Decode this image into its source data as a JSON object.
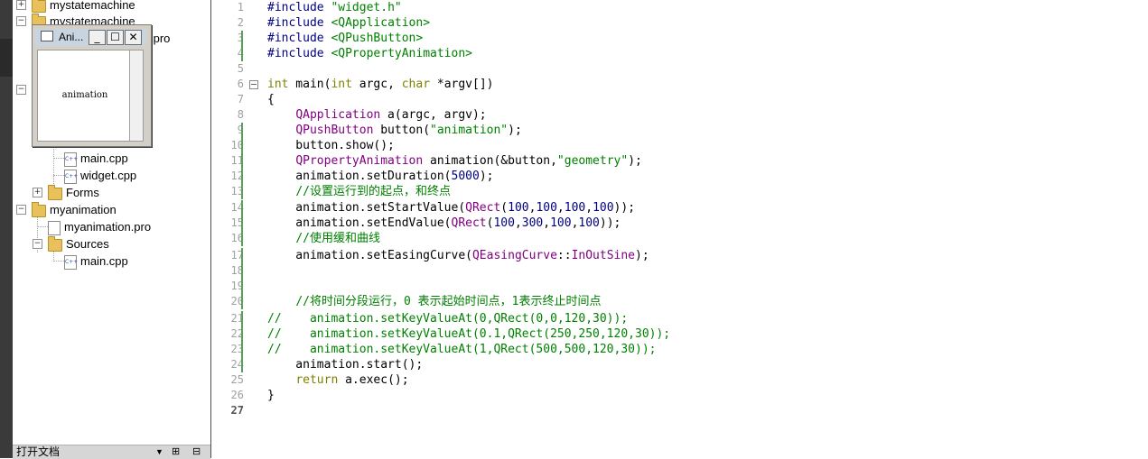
{
  "project_tree": {
    "items": [
      {
        "label": "mystatemachine",
        "kind": "project"
      },
      {
        "label": "mystatemachine",
        "kind": "project"
      },
      {
        "label": ".pro",
        "kind": "pro"
      },
      {
        "label": "main.cpp",
        "kind": "cpp"
      },
      {
        "label": "widget.cpp",
        "kind": "cpp"
      },
      {
        "label": "Forms",
        "kind": "folder"
      },
      {
        "label": "myanimation",
        "kind": "project"
      },
      {
        "label": "myanimation.pro",
        "kind": "pro"
      },
      {
        "label": "Sources",
        "kind": "folder"
      },
      {
        "label": "main.cpp",
        "kind": "cpp"
      }
    ]
  },
  "bottom_bar": {
    "label": "打开文档"
  },
  "anim_window": {
    "title": "Ani...",
    "minimize_glyph": "_",
    "maximize_glyph": "☐",
    "close_glyph": "✕",
    "button_text": "animation"
  },
  "editor": {
    "line_numbers": [
      "1",
      "2",
      "3",
      "4",
      "5",
      "6",
      "7",
      "8",
      "9",
      "10",
      "11",
      "12",
      "13",
      "14",
      "15",
      "16",
      "17",
      "18",
      "19",
      "20",
      "21",
      "22",
      "23",
      "24",
      "25",
      "26",
      "27"
    ],
    "current_line": "27",
    "lines": [
      [
        {
          "t": "#include ",
          "c": "inc"
        },
        {
          "t": "\"widget.h\"",
          "c": "str"
        }
      ],
      [
        {
          "t": "#include ",
          "c": "inc"
        },
        {
          "t": "<QApplication>",
          "c": "str"
        }
      ],
      [
        {
          "t": "#include ",
          "c": "inc"
        },
        {
          "t": "<QPushButton>",
          "c": "str"
        }
      ],
      [
        {
          "t": "#include ",
          "c": "inc"
        },
        {
          "t": "<QPropertyAnimation>",
          "c": "str"
        }
      ],
      [],
      [
        {
          "t": "int",
          "c": "kw"
        },
        {
          "t": " main(",
          "c": ""
        },
        {
          "t": "int",
          "c": "kw"
        },
        {
          "t": " argc, ",
          "c": ""
        },
        {
          "t": "char",
          "c": "kw"
        },
        {
          "t": " *argv[])",
          "c": ""
        }
      ],
      [
        {
          "t": "{",
          "c": ""
        }
      ],
      [
        {
          "t": "    ",
          "c": ""
        },
        {
          "t": "QApplication",
          "c": "cls"
        },
        {
          "t": " a(argc, argv);",
          "c": ""
        }
      ],
      [
        {
          "t": "    ",
          "c": ""
        },
        {
          "t": "QPushButton",
          "c": "cls"
        },
        {
          "t": " button(",
          "c": ""
        },
        {
          "t": "\"animation\"",
          "c": "str"
        },
        {
          "t": ");",
          "c": ""
        }
      ],
      [
        {
          "t": "    button.show();",
          "c": ""
        }
      ],
      [
        {
          "t": "    ",
          "c": ""
        },
        {
          "t": "QPropertyAnimation",
          "c": "cls"
        },
        {
          "t": " animation(&button,",
          "c": ""
        },
        {
          "t": "\"geometry\"",
          "c": "str"
        },
        {
          "t": ");",
          "c": ""
        }
      ],
      [
        {
          "t": "    animation.setDuration(",
          "c": ""
        },
        {
          "t": "5000",
          "c": "num"
        },
        {
          "t": ");",
          "c": ""
        }
      ],
      [
        {
          "t": "    ",
          "c": ""
        },
        {
          "t": "//设置运行到的起点，和终点",
          "c": "cmt"
        }
      ],
      [
        {
          "t": "    animation.setStartValue(",
          "c": ""
        },
        {
          "t": "QRect",
          "c": "cls"
        },
        {
          "t": "(",
          "c": ""
        },
        {
          "t": "100",
          "c": "num"
        },
        {
          "t": ",",
          "c": ""
        },
        {
          "t": "100",
          "c": "num"
        },
        {
          "t": ",",
          "c": ""
        },
        {
          "t": "100",
          "c": "num"
        },
        {
          "t": ",",
          "c": ""
        },
        {
          "t": "100",
          "c": "num"
        },
        {
          "t": "));",
          "c": ""
        }
      ],
      [
        {
          "t": "    animation.setEndValue(",
          "c": ""
        },
        {
          "t": "QRect",
          "c": "cls"
        },
        {
          "t": "(",
          "c": ""
        },
        {
          "t": "100",
          "c": "num"
        },
        {
          "t": ",",
          "c": ""
        },
        {
          "t": "300",
          "c": "num"
        },
        {
          "t": ",",
          "c": ""
        },
        {
          "t": "100",
          "c": "num"
        },
        {
          "t": ",",
          "c": ""
        },
        {
          "t": "100",
          "c": "num"
        },
        {
          "t": "));",
          "c": ""
        }
      ],
      [
        {
          "t": "    ",
          "c": ""
        },
        {
          "t": "//使用缓和曲线",
          "c": "cmt"
        }
      ],
      [
        {
          "t": "    animation.setEasingCurve(",
          "c": ""
        },
        {
          "t": "QEasingCurve",
          "c": "cls"
        },
        {
          "t": "::",
          "c": ""
        },
        {
          "t": "InOutSine",
          "c": "cls"
        },
        {
          "t": ");",
          "c": ""
        }
      ],
      [],
      [],
      [
        {
          "t": "    ",
          "c": ""
        },
        {
          "t": "//将时间分段运行，0 表示起始时间点，1表示终止时间点",
          "c": "cmt"
        }
      ],
      [
        {
          "t": "//    animation.setKeyValueAt(0,QRect(0,0,120,30));",
          "c": "cmt"
        }
      ],
      [
        {
          "t": "//    animation.setKeyValueAt(0.1,QRect(250,250,120,30));",
          "c": "cmt"
        }
      ],
      [
        {
          "t": "//    animation.setKeyValueAt(1,QRect(500,500,120,30));",
          "c": "cmt"
        }
      ],
      [
        {
          "t": "    animation.start();",
          "c": ""
        }
      ],
      [
        {
          "t": "    ",
          "c": ""
        },
        {
          "t": "return",
          "c": "kw"
        },
        {
          "t": " a.exec();",
          "c": ""
        }
      ],
      [
        {
          "t": "}",
          "c": ""
        }
      ],
      []
    ]
  }
}
